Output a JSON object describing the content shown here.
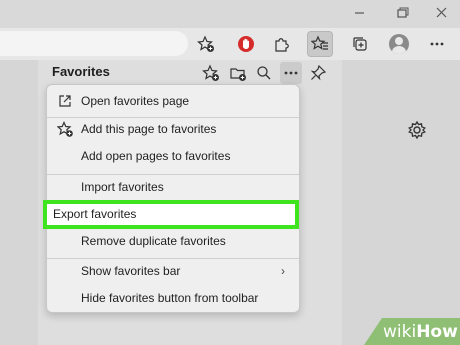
{
  "window_controls": [
    "minimize",
    "restore",
    "close"
  ],
  "toolbar": {
    "icons": [
      "star-plus-icon",
      "extension-red-icon",
      "puzzle-icon",
      "favorites-icon",
      "collections-icon",
      "profile-avatar",
      "more-icon"
    ]
  },
  "favorites": {
    "title": "Favorites",
    "header_icons": [
      "star-plus-icon",
      "folder-plus-icon",
      "search-icon",
      "more-icon",
      "pin-icon"
    ]
  },
  "menu": {
    "items": [
      {
        "label": "Open favorites page",
        "icon": "external-link-icon"
      },
      {
        "label": "Add this page to favorites",
        "icon": "star-plus-icon"
      },
      {
        "label": "Add open pages to favorites",
        "icon": ""
      },
      {
        "label": "Import favorites",
        "icon": ""
      },
      {
        "label": "Export favorites",
        "icon": "",
        "highlighted": true
      },
      {
        "label": "Remove duplicate favorites",
        "icon": ""
      },
      {
        "label": "Show favorites bar",
        "icon": "",
        "submenu": true
      },
      {
        "label": "Hide favorites button from toolbar",
        "icon": ""
      }
    ],
    "submenu_arrow": "›"
  },
  "watermark": {
    "wiki": "wiki",
    "how": "How"
  },
  "colors": {
    "highlight_border": "#3ee51e",
    "watermark_bg": "#8fbf74"
  }
}
